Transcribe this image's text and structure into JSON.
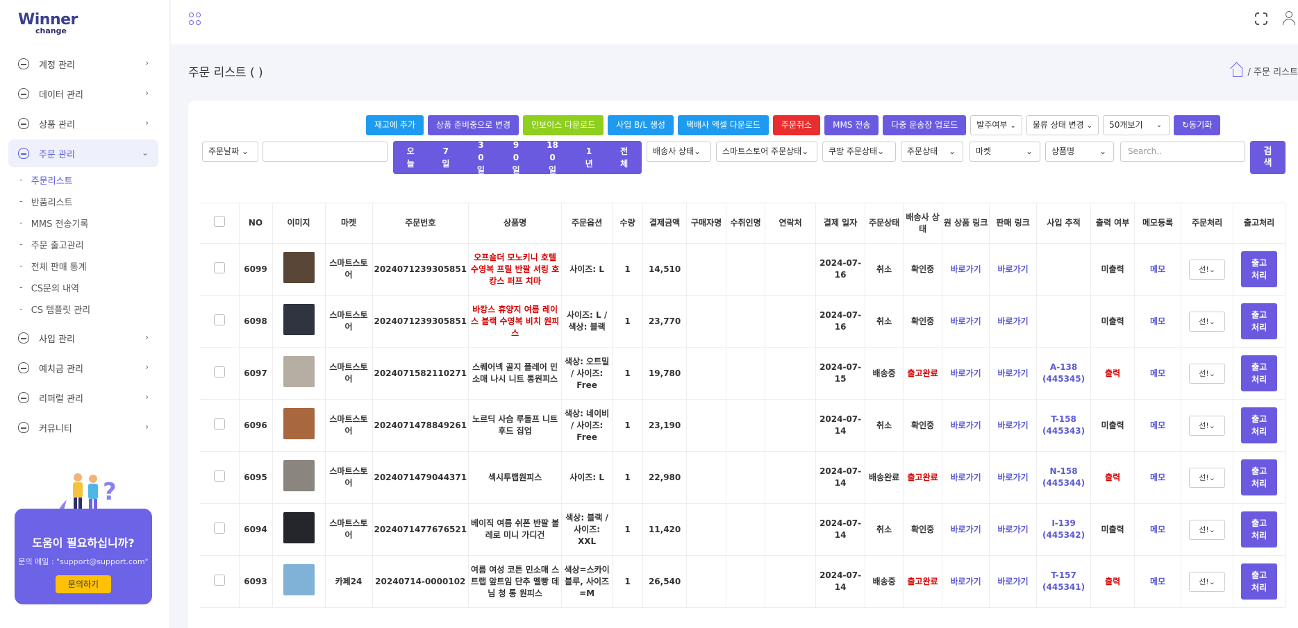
{
  "brand": {
    "line1": "Winner",
    "line2": "change"
  },
  "sidebar": {
    "items": [
      {
        "label": "계정 관리"
      },
      {
        "label": "데이터 관리"
      },
      {
        "label": "상품 관리"
      },
      {
        "label": "주문 관리"
      },
      {
        "label": "사입 관리"
      },
      {
        "label": "예치금 관리"
      },
      {
        "label": "리퍼럴 관리"
      },
      {
        "label": "커뮤니티"
      }
    ],
    "subitems": [
      {
        "label": "주문리스트"
      },
      {
        "label": "반품리스트"
      },
      {
        "label": "MMS 전송기록"
      },
      {
        "label": "주문 출고관리"
      },
      {
        "label": "전체 판매 통계"
      },
      {
        "label": "CS문의 내역"
      },
      {
        "label": "CS 템플릿 관리"
      }
    ]
  },
  "help": {
    "title": "도움이 필요하십니까?",
    "mail": "문의 메일 : \"support@support.com\"",
    "button": "문의하기"
  },
  "page": {
    "title": "주문 리스트 ( )",
    "breadcrumb": "/  주문 리스트"
  },
  "toolbar": {
    "buttons": [
      "재고에 추가",
      "상품 준비중으로 변경",
      "인보이스 다운로드",
      "사입 B/L 생성",
      "택배사 엑셀 다운로드",
      "주문취소",
      "MMS 전송",
      "다중 운송장 업로드"
    ],
    "selects": [
      "발주여부",
      "물류 상태 변경",
      "50개보기"
    ],
    "sync": "↻동기화"
  },
  "filters": {
    "date_select": "주문날짜",
    "ranges": [
      "오늘",
      "7일",
      "30일",
      "90일",
      "180일",
      "1년",
      "전체"
    ],
    "selects": [
      "배송사 상태",
      "스마트스토어 주문상태",
      "쿠팡 주문상태",
      "주문상태",
      "마켓",
      "상품명"
    ],
    "search_placeholder": "Search..",
    "search_button": "검색"
  },
  "table": {
    "headers": [
      "NO",
      "이미지",
      "마켓",
      "주문번호",
      "상품명",
      "주문옵션",
      "수량",
      "결제금액",
      "구매자명",
      "수취인명",
      "연락처",
      "결제 일자",
      "주문상태",
      "배송사 상태",
      "원 상품 링크",
      "판매 링크",
      "사입 추적",
      "출력 여부",
      "메모등록",
      "주문처리",
      "출고처리"
    ],
    "rows": [
      {
        "no": "6099",
        "market": "스마트스토어",
        "order": "2024071239305851",
        "product": "오프숄더 모노키니 호텔 수영복 프릴 반팔 셔링 호캉스 퍼프 치마",
        "product_red": true,
        "option": "사이즈: L",
        "qty": "1",
        "amount": "14,510",
        "date": "2024-07-16",
        "status": "취소",
        "ship": "확인중",
        "ship_red": false,
        "link1": "바로가기",
        "link2": "바로가기",
        "track": "",
        "print": "미출력",
        "print_red": false,
        "memo": "메모",
        "sel": "선!",
        "out": "출고처리",
        "thumb": "#5a4636"
      },
      {
        "no": "6098",
        "market": "스마트스토어",
        "order": "2024071239305851",
        "product": "바캉스 휴양지 여름 레이스 블랙 수영복 비치 원피스",
        "product_red": true,
        "option": "사이즈: L / 색상: 블랙",
        "qty": "1",
        "amount": "23,770",
        "date": "2024-07-16",
        "status": "취소",
        "ship": "확인중",
        "ship_red": false,
        "link1": "바로가기",
        "link2": "바로가기",
        "track": "",
        "print": "미출력",
        "print_red": false,
        "memo": "메모",
        "sel": "선!",
        "out": "출고처리",
        "thumb": "#2f3440"
      },
      {
        "no": "6097",
        "market": "스마트스토어",
        "order": "2024071582110271",
        "product": "스퀘어넥 골지 플레어 민소매 나시 니트 통원피스",
        "product_red": false,
        "option": "색상: 오트밀 / 사이즈: Free",
        "qty": "1",
        "amount": "19,780",
        "date": "2024-07-15",
        "status": "배송중",
        "ship": "출고완료",
        "ship_red": true,
        "link1": "바로가기",
        "link2": "바로가기",
        "track": "A-138 (445345)",
        "print": "출력",
        "print_red": true,
        "memo": "메모",
        "sel": "선!",
        "out": "출고처리",
        "thumb": "#b7aea3"
      },
      {
        "no": "6096",
        "market": "스마트스토어",
        "order": "2024071478849261",
        "product": "노르딕 사슴 루돌프 니트 후드 집업",
        "product_red": false,
        "option": "색상: 네이비 / 사이즈: Free",
        "qty": "1",
        "amount": "23,190",
        "date": "2024-07-14",
        "status": "취소",
        "ship": "확인중",
        "ship_red": false,
        "link1": "바로가기",
        "link2": "바로가기",
        "track": "T-158 (445343)",
        "print": "미출력",
        "print_red": false,
        "memo": "메모",
        "sel": "선!",
        "out": "출고처리",
        "thumb": "#a8673e"
      },
      {
        "no": "6095",
        "market": "스마트스토어",
        "order": "2024071479044371",
        "product": "섹시투랩원피스",
        "product_red": false,
        "option": "사이즈: L",
        "qty": "1",
        "amount": "22,980",
        "date": "2024-07-14",
        "status": "배송완료",
        "ship": "출고완료",
        "ship_red": true,
        "link1": "바로가기",
        "link2": "바로가기",
        "track": "N-158 (445344)",
        "print": "출력",
        "print_red": true,
        "memo": "메모",
        "sel": "선!",
        "out": "출고처리",
        "thumb": "#8b8580"
      },
      {
        "no": "6094",
        "market": "스마트스토어",
        "order": "2024071477676521",
        "product": "베이직 여름 쉬폰 반팔 볼레로 미니 가디건",
        "product_red": false,
        "option": "색상: 블랙 / 사이즈: XXL",
        "qty": "1",
        "amount": "11,420",
        "date": "2024-07-14",
        "status": "취소",
        "ship": "확인중",
        "ship_red": false,
        "link1": "바로가기",
        "link2": "바로가기",
        "track": "I-139 (445342)",
        "print": "미출력",
        "print_red": false,
        "memo": "메모",
        "sel": "선!",
        "out": "출고처리",
        "thumb": "#24262b"
      },
      {
        "no": "6093",
        "market": "카페24",
        "order": "20240714-0000102",
        "product": "여름 여성 코튼 민소매 스트랩 앞트임 단추 멜빵 데님 청 통 원피스",
        "product_red": false,
        "option": "색상=스카이블루, 사이즈=M",
        "qty": "1",
        "amount": "26,540",
        "date": "2024-07-14",
        "status": "배송중",
        "ship": "출고완료",
        "ship_red": true,
        "link1": "바로가기",
        "link2": "바로가기",
        "track": "T-157 (445341)",
        "print": "출력",
        "print_red": true,
        "memo": "메모",
        "sel": "선!",
        "out": "출고처리",
        "thumb": "#7fb2d6"
      }
    ]
  },
  "colors": {
    "accent": "#6a5ae0",
    "blue": "#1e9bf0",
    "green": "#8fcf1e",
    "red": "#ea2d2d"
  }
}
